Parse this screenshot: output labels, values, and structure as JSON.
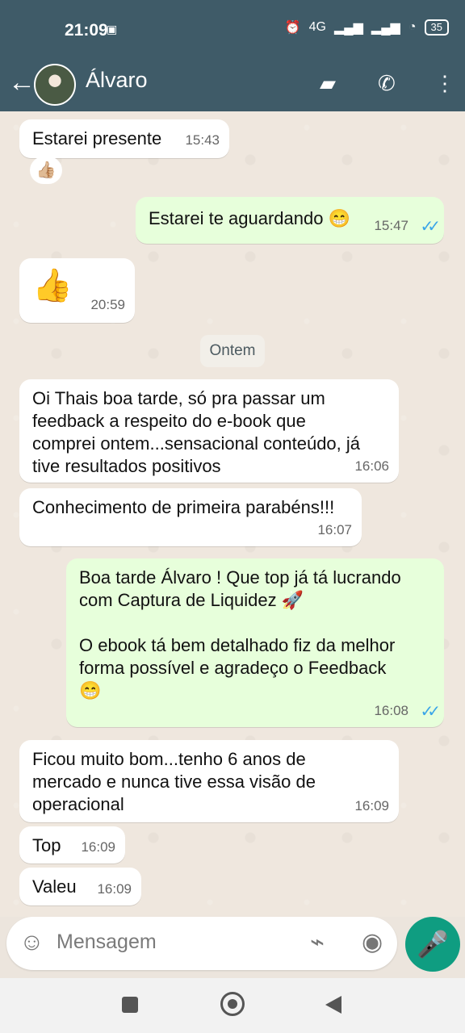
{
  "status_bar": {
    "time": "21:09",
    "network": "4G",
    "battery": "35"
  },
  "header": {
    "contact_name": "Álvaro"
  },
  "chat": {
    "date_divider": "Ontem",
    "reaction": "👍🏼",
    "messages": [
      {
        "direction": "incoming",
        "text": "Estarei presente",
        "time": "15:43"
      },
      {
        "direction": "outgoing",
        "text": "Estarei te aguardando 😁",
        "time": "15:47",
        "ticks": "✓✓"
      },
      {
        "direction": "incoming",
        "text": "👍",
        "time": "20:59"
      },
      {
        "direction": "incoming",
        "text": "Oi Thais boa tarde, só pra passar um\nfeedback a respeito do e-book que\ncomprei ontem...sensacional conteúdo, já\ntive resultados positivos",
        "time": "16:06"
      },
      {
        "direction": "incoming",
        "text": "Conhecimento de primeira parabéns!!!",
        "time": "16:07"
      },
      {
        "direction": "outgoing",
        "text": "Boa tarde Álvaro ! Que top já tá lucrando\ncom Captura de Liquidez 🚀\n\nO ebook tá bem detalhado fiz da melhor\nforma possível e agradeço o Feedback\n😁",
        "time": "16:08",
        "ticks": "✓✓"
      },
      {
        "direction": "incoming",
        "text": "Ficou muito bom...tenho 6 anos de\nmercado e nunca tive essa visão de\noperacional",
        "time": "16:09"
      },
      {
        "direction": "incoming",
        "text": "Top",
        "time": "16:09"
      },
      {
        "direction": "incoming",
        "text": "Valeu",
        "time": "16:09"
      }
    ]
  },
  "composer": {
    "placeholder": "Mensagem"
  },
  "icons": {
    "back": "arrow-left-icon",
    "video": "video-camera-icon",
    "call": "phone-icon",
    "menu": "more-vertical-icon",
    "emoji": "emoji-icon",
    "attach": "paperclip-icon",
    "camera": "camera-icon",
    "mic": "microphone-icon"
  }
}
